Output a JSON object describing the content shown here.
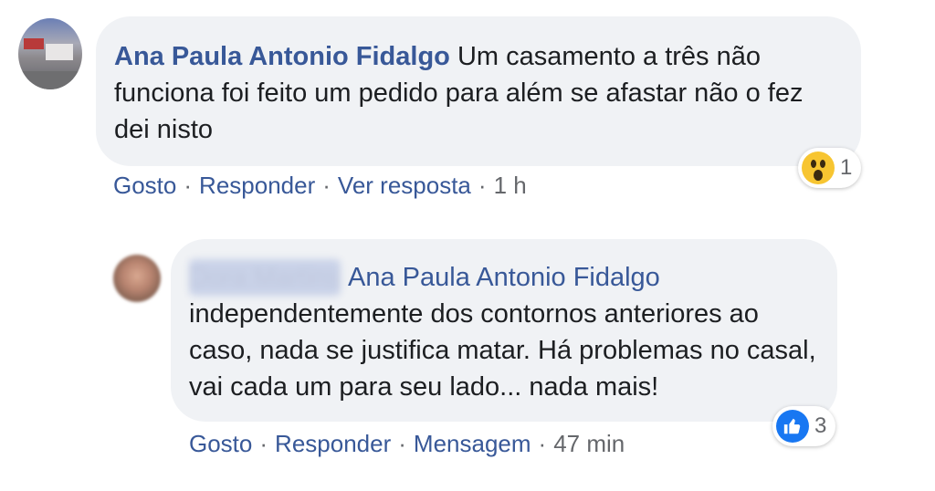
{
  "comment": {
    "author": "Ana Paula Antonio Fidalgo",
    "text": "Um casamento a três não funciona foi feito um pedido para além se afastar não o fez dei nisto",
    "reaction": {
      "icon": "wow-icon",
      "count": "1"
    },
    "actions": {
      "like": "Gosto",
      "reply": "Responder",
      "view_reply": "Ver resposta",
      "time": "1 h"
    }
  },
  "reply": {
    "author_blurred": "Dora Martins",
    "mention": "Ana Paula Antonio Fidalgo",
    "text": "independentemente dos contornos anteriores ao caso, nada se justifica matar. Há problemas no casal, vai cada um para seu lado... nada mais!",
    "reaction": {
      "icon": "like-icon",
      "count": "3"
    },
    "actions": {
      "like": "Gosto",
      "reply": "Responder",
      "message": "Mensagem",
      "time": "47 min"
    }
  },
  "separator": "·",
  "colors": {
    "link": "#385898",
    "bubble": "#f0f2f5",
    "like": "#1877f2",
    "wow": "#f7c531"
  }
}
